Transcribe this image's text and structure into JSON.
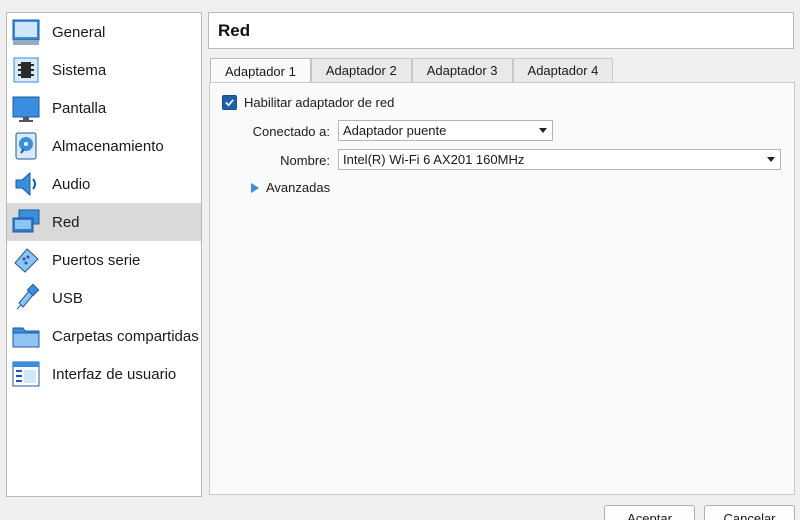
{
  "sidebar": {
    "items": [
      {
        "label": "General",
        "icon": "monitor-general-icon"
      },
      {
        "label": "Sistema",
        "icon": "chip-icon"
      },
      {
        "label": "Pantalla",
        "icon": "display-icon"
      },
      {
        "label": "Almacenamiento",
        "icon": "disk-icon"
      },
      {
        "label": "Audio",
        "icon": "speaker-icon"
      },
      {
        "label": "Red",
        "icon": "network-icon"
      },
      {
        "label": "Puertos serie",
        "icon": "serial-port-icon"
      },
      {
        "label": "USB",
        "icon": "usb-icon"
      },
      {
        "label": "Carpetas compartidas",
        "icon": "folder-icon"
      },
      {
        "label": "Interfaz de usuario",
        "icon": "window-ui-icon"
      }
    ],
    "selected": "Red"
  },
  "header": {
    "title": "Red"
  },
  "tabs": [
    {
      "label": "Adaptador 1",
      "active": true
    },
    {
      "label": "Adaptador 2",
      "active": false
    },
    {
      "label": "Adaptador 3",
      "active": false
    },
    {
      "label": "Adaptador 4",
      "active": false
    }
  ],
  "form": {
    "enable_label": "Habilitar adaptador de red",
    "enable_checked": true,
    "connected_label": "Conectado a:",
    "connected_value": "Adaptador puente",
    "name_label": "Nombre:",
    "name_value": "Intel(R) Wi-Fi 6 AX201 160MHz",
    "advanced_label": "Avanzadas"
  },
  "buttons": {
    "ok": "Aceptar",
    "cancel": "Cancelar"
  },
  "colors": {
    "accent": "#1f5fa8",
    "selected_bg": "#d9d9d9",
    "expander": "#3a8ee0"
  }
}
